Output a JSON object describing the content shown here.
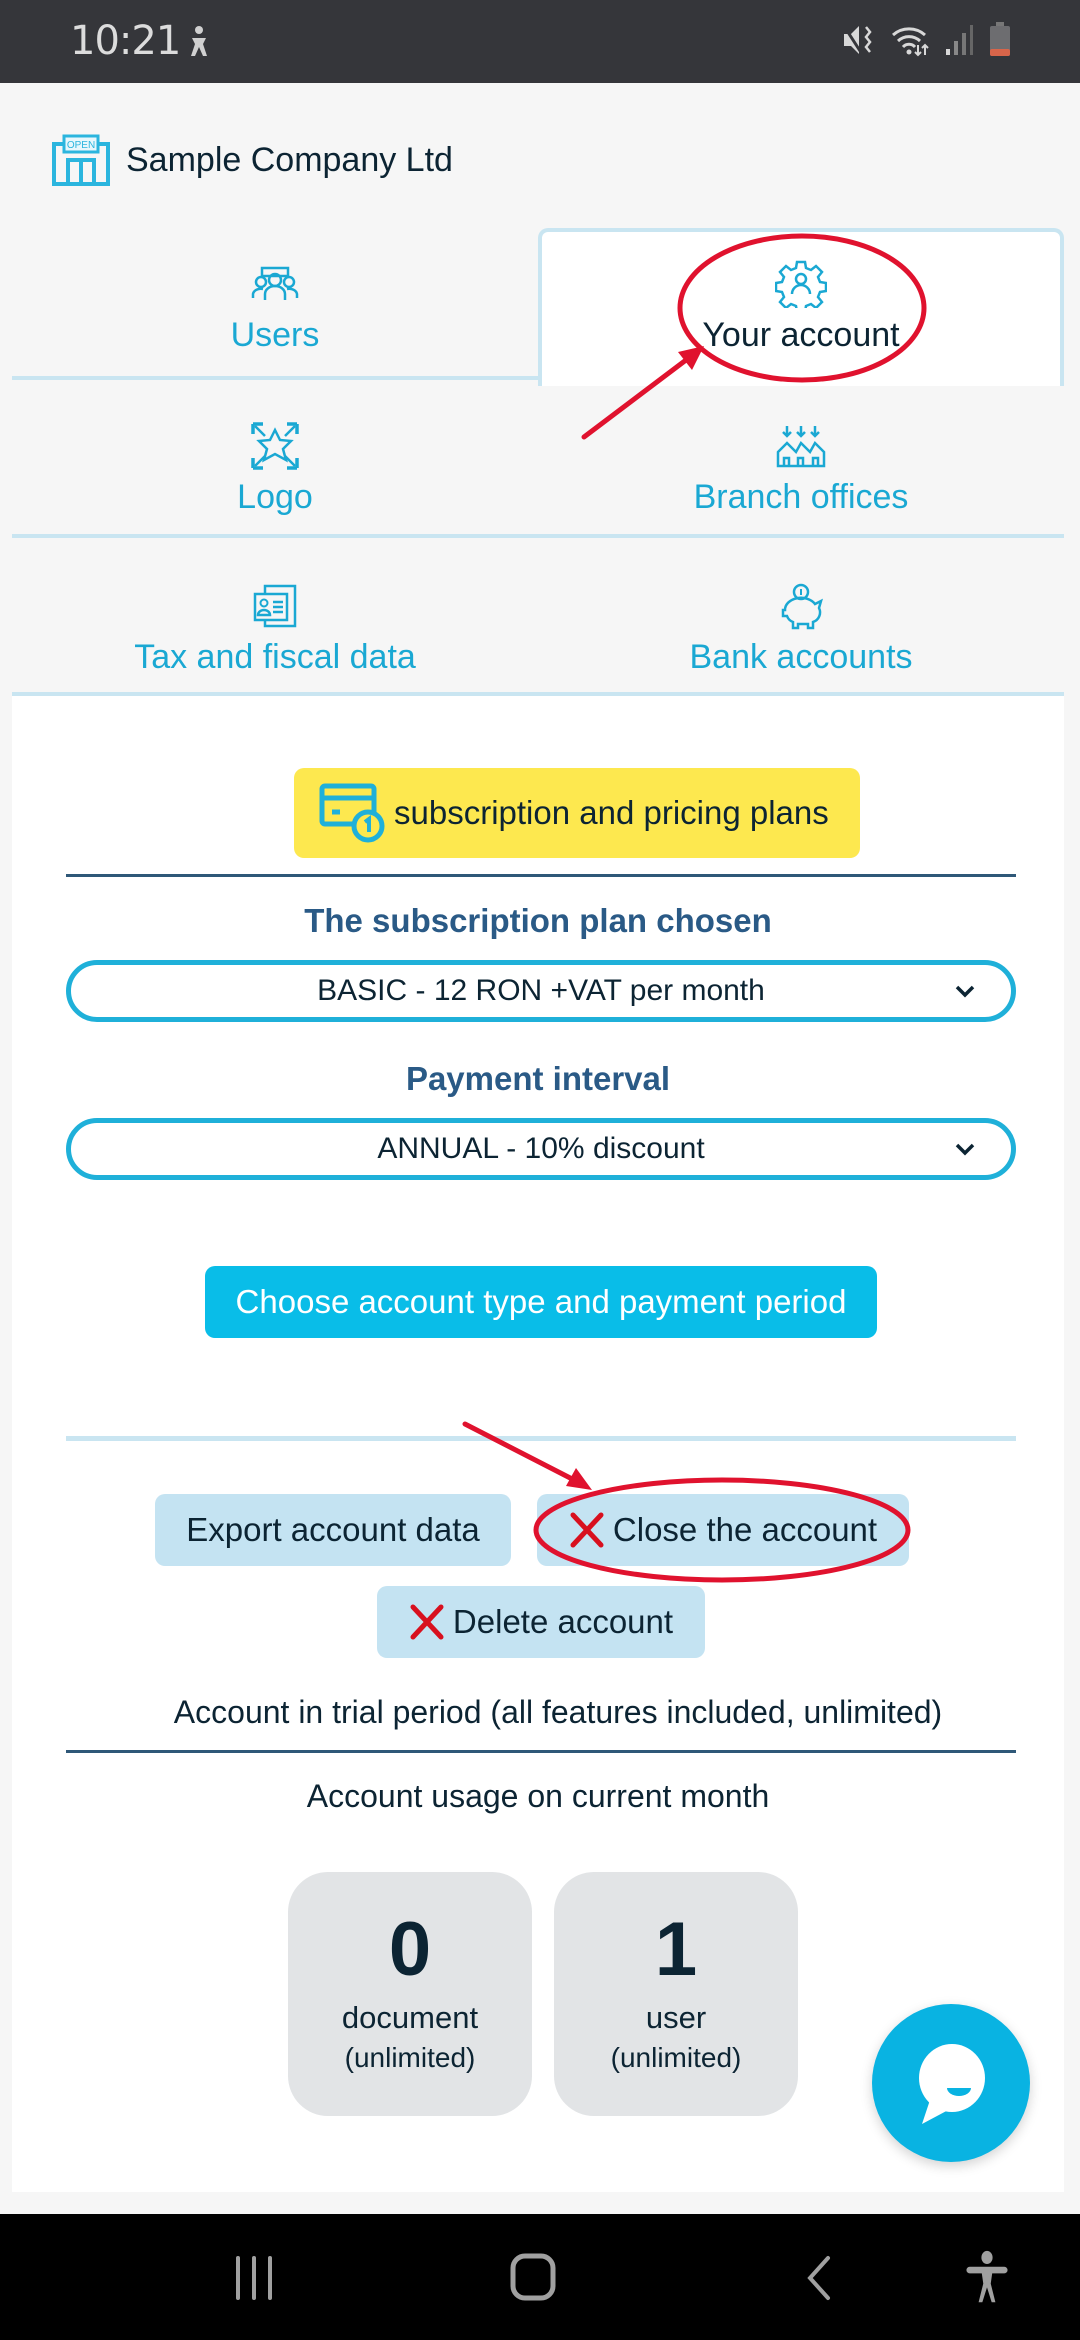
{
  "status_bar": {
    "time": "10:21",
    "icons": [
      "accessibility-notification-icon",
      "mute-vibrate-icon",
      "wifi-icon",
      "signal-icon",
      "battery-low-icon"
    ]
  },
  "header": {
    "company_name": "Sample Company Ltd",
    "icon": "shop-open-icon"
  },
  "tabs": [
    {
      "label": "Users",
      "icon": "users-icon",
      "active": false
    },
    {
      "label": "Your account",
      "icon": "account-gear-icon",
      "active": true
    },
    {
      "label": "Logo",
      "icon": "logo-icon",
      "active": false
    },
    {
      "label": "Branch offices",
      "icon": "branch-offices-icon",
      "active": false
    },
    {
      "label": "Tax and fiscal data",
      "icon": "tax-id-icon",
      "active": false
    },
    {
      "label": "Bank accounts",
      "icon": "piggy-bank-icon",
      "active": false
    }
  ],
  "account": {
    "pricing_button": "subscription and pricing plans",
    "plan_label": "The subscription plan chosen",
    "plan_value": "BASIC - 12 RON +VAT per month",
    "interval_label": "Payment interval",
    "interval_value": "ANNUAL - 10% discount",
    "choose_button": "Choose account type and payment period",
    "export_button": "Export account data",
    "close_button": "Close the account",
    "delete_button": "Delete account",
    "trial_text": "Account in trial period (all features included, unlimited)",
    "usage_title": "Account usage on current month",
    "usage": [
      {
        "value": "0",
        "unit": "document",
        "limit": "(unlimited)"
      },
      {
        "value": "1",
        "unit": "user",
        "limit": "(unlimited)"
      }
    ]
  },
  "colors": {
    "accent": "#1aa8d3",
    "primary_button": "#09bde8",
    "pricing_button": "#fde84f",
    "annotation": "#e0122e"
  }
}
